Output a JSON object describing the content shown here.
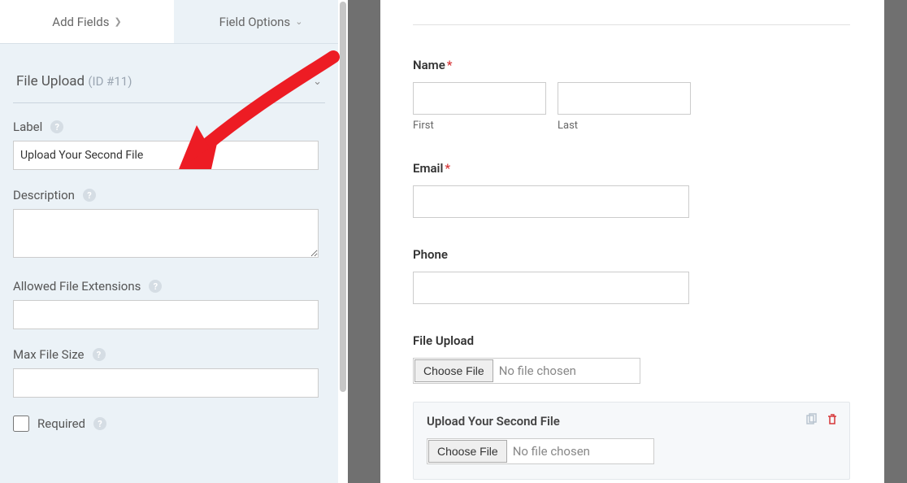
{
  "tabs": {
    "add_fields": "Add Fields",
    "field_options": "Field Options"
  },
  "section": {
    "title": "File Upload",
    "id": "(ID #11)"
  },
  "options": {
    "label": {
      "text": "Label",
      "value": "Upload Your Second File"
    },
    "description": {
      "text": "Description",
      "value": ""
    },
    "allowed_ext": {
      "text": "Allowed File Extensions",
      "value": ""
    },
    "max_size": {
      "text": "Max File Size",
      "value": ""
    },
    "required": {
      "text": "Required"
    }
  },
  "preview": {
    "name": {
      "label": "Name",
      "first": "First",
      "last": "Last"
    },
    "email": {
      "label": "Email"
    },
    "phone": {
      "label": "Phone"
    },
    "file1": {
      "label": "File Upload",
      "btn": "Choose File",
      "placeholder": "No file chosen"
    },
    "file2": {
      "label": "Upload Your Second File",
      "btn": "Choose File",
      "placeholder": "No file chosen"
    }
  },
  "required_mark": "*"
}
